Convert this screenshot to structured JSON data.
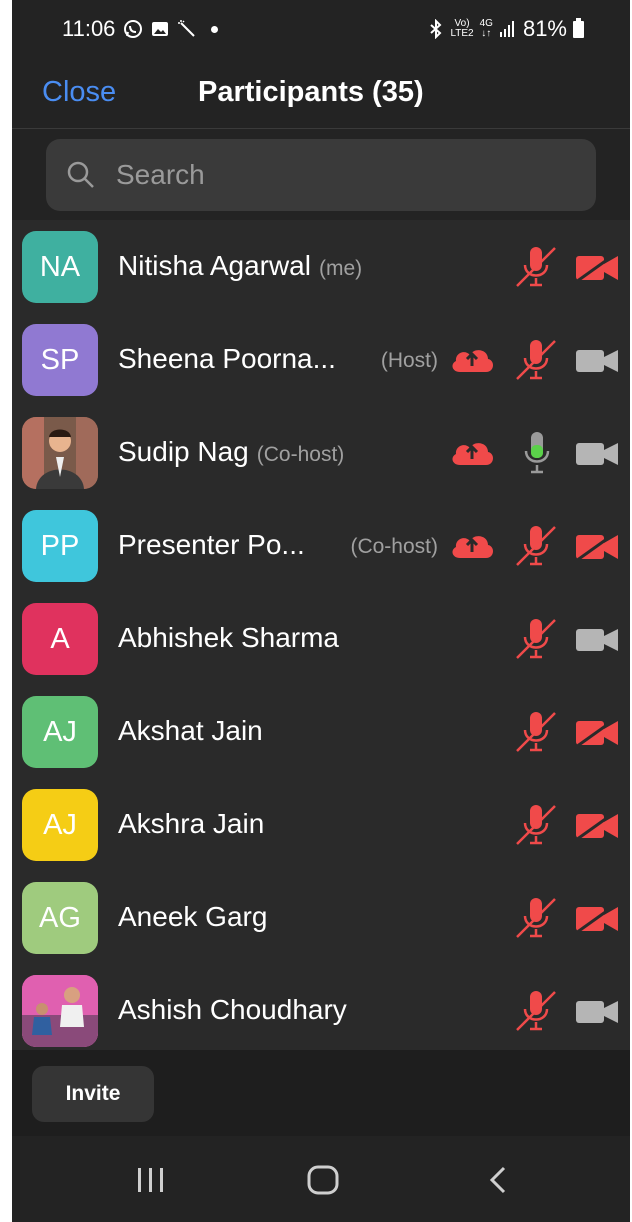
{
  "status_bar": {
    "time": "11:06",
    "network_label": "Vo) LTE2",
    "network_label_top": "Vo)",
    "network_label_bottom": "LTE2",
    "data_label_top": "4G",
    "data_label_bottom": "↓↑",
    "battery": "81%"
  },
  "header": {
    "close_label": "Close",
    "title": "Participants (35)"
  },
  "search": {
    "placeholder": "Search"
  },
  "participants": [
    {
      "initials": "NA",
      "color": "#3fb0a0",
      "name": "Nitisha Agarwal",
      "role": "(me)",
      "cloud": false,
      "mic": "muted",
      "video": "off"
    },
    {
      "initials": "SP",
      "color": "#9079d2",
      "name": "Sheena Poorna...",
      "role": "(Host)",
      "cloud": true,
      "mic": "muted",
      "video": "on"
    },
    {
      "initials": "",
      "color": "#6b4b3b",
      "name": "Sudip Nag",
      "role": "(Co-host)",
      "cloud": true,
      "mic": "active",
      "video": "on",
      "photo": true
    },
    {
      "initials": "PP",
      "color": "#3fc6dc",
      "name": "Presenter Po...",
      "role": "(Co-host)",
      "cloud": true,
      "mic": "muted",
      "video": "off"
    },
    {
      "initials": "A",
      "color": "#e0325e",
      "name": "Abhishek Sharma",
      "role": "",
      "cloud": false,
      "mic": "muted",
      "video": "on"
    },
    {
      "initials": "AJ",
      "color": "#5fbf75",
      "name": "Akshat Jain",
      "role": "",
      "cloud": false,
      "mic": "muted",
      "video": "off"
    },
    {
      "initials": "AJ",
      "color": "#f5cd15",
      "name": "Akshra Jain",
      "role": "",
      "cloud": false,
      "mic": "muted",
      "video": "off"
    },
    {
      "initials": "AG",
      "color": "#9fcb7e",
      "name": "Aneek Garg",
      "role": "",
      "cloud": false,
      "mic": "muted",
      "video": "off"
    },
    {
      "initials": "",
      "color": "#c94f9a",
      "name": "Ashish Choudhary",
      "role": "",
      "cloud": false,
      "mic": "muted",
      "video": "on",
      "photo": true
    }
  ],
  "footer": {
    "invite_label": "Invite"
  },
  "nav": {
    "recents_icon": "recents-icon",
    "home_icon": "home-icon",
    "back_icon": "back-icon"
  },
  "colors": {
    "accent": "#4a8df2",
    "muted_red": "#f04a4a",
    "active_green": "#5bd14a",
    "video_gray": "#b5b5b5"
  }
}
